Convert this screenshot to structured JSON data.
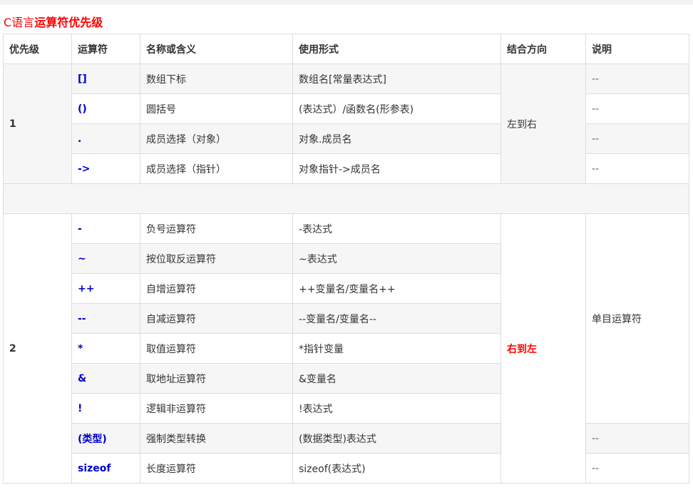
{
  "title": {
    "prefix": "C语言",
    "main": "运算符优先级"
  },
  "headers": [
    "优先级",
    "运算符",
    "名称或含义",
    "使用形式",
    "结合方向",
    "说明"
  ],
  "group1": {
    "priority": "1",
    "direction": "左到右",
    "rows": [
      {
        "op": "[]",
        "name": "数组下标",
        "form": "数组名[常量表达式]",
        "note": "--"
      },
      {
        "op": "()",
        "name": "圆括号",
        "form": "(表达式）/函数名(形参表)",
        "note": "--"
      },
      {
        "op": ".",
        "name": "成员选择（对象）",
        "form": "对象.成员名",
        "note": "--"
      },
      {
        "op": "->",
        "name": "成员选择（指针）",
        "form": "对象指针->成员名",
        "note": "--"
      }
    ]
  },
  "group2": {
    "priority": "2",
    "direction": "右到左",
    "unary_note": "单目运算符",
    "rows": [
      {
        "op": "-",
        "name": "负号运算符",
        "form": "-表达式"
      },
      {
        "op": "~",
        "name": "按位取反运算符",
        "form": "~表达式"
      },
      {
        "op": "++",
        "name": "自增运算符",
        "form": "++变量名/变量名++"
      },
      {
        "op": "--",
        "name": "自减运算符",
        "form": "--变量名/变量名--"
      },
      {
        "op": "*",
        "name": "取值运算符",
        "form": "*指针变量"
      },
      {
        "op": "&",
        "name": "取地址运算符",
        "form": "&变量名"
      },
      {
        "op": "!",
        "name": "逻辑非运算符",
        "form": "!表达式"
      },
      {
        "op": "(类型)",
        "name": "强制类型转换",
        "form": "(数据类型)表达式",
        "note": "--"
      },
      {
        "op": "sizeof",
        "name": "长度运算符",
        "form": "sizeof(表达式)",
        "note": "--"
      }
    ]
  },
  "colors": {
    "title": "#ff0000",
    "operator": "#0000cc",
    "highlight": "#ff0000",
    "border": "#dddddd",
    "row_alt": "#f6f6f6"
  }
}
